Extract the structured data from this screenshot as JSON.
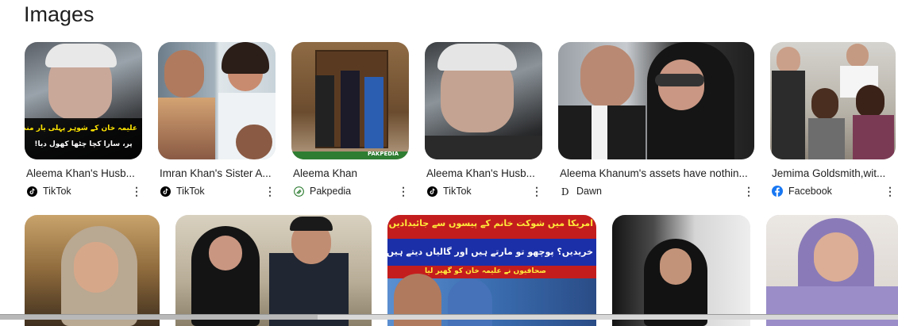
{
  "section": {
    "title": "Images"
  },
  "row1": [
    {
      "title": "Aleema Khan's Husb...",
      "source": "TikTok",
      "source_icon": "tiktok-icon",
      "overlay": [
        "علیمہ خان کے شوہر پہلی بار منظر عام",
        "پر، سارا کچا چٹھا کھول دیا!"
      ]
    },
    {
      "title": "Imran Khan's Sister A...",
      "source": "TikTok",
      "source_icon": "tiktok-icon"
    },
    {
      "title": "Aleema Khan",
      "source": "Pakpedia",
      "source_icon": "pakpedia-icon",
      "overlay": [
        "PAKPEDIA"
      ]
    },
    {
      "title": "Aleema Khan's Husb...",
      "source": "TikTok",
      "source_icon": "tiktok-icon"
    },
    {
      "title": "Aleema Khanum's assets have nothin...",
      "source": "Dawn",
      "source_icon": "dawn-icon"
    },
    {
      "title": "Jemima Goldsmith,wit...",
      "source": "Facebook",
      "source_icon": "facebook-icon"
    }
  ],
  "row2": [
    {
      "alt": "image"
    },
    {
      "alt": "image"
    },
    {
      "alt": "image",
      "overlay": [
        "امریکا میں شوکت خانم کے پیسوں سے جائیدادیں نہیں",
        "خریدیں؟ پوچھو تو مارتے ہیں اور گالیاں دیتے ہیں",
        "صحافیوں نے علیمہ خان کو گھیر لیا"
      ]
    },
    {
      "alt": "image"
    },
    {
      "alt": "image"
    }
  ],
  "colors": {
    "tiktok": "#000000",
    "pakpedia": "#2e7d32",
    "facebook": "#1877f2",
    "banner_red": "#c41d1d",
    "banner_blue": "#1b2fa8"
  }
}
